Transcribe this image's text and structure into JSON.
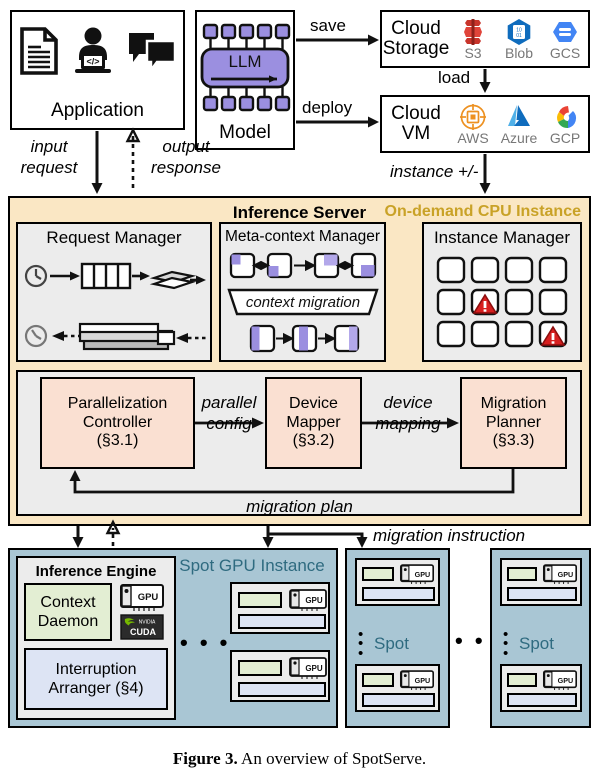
{
  "figure": {
    "caption_bold": "Figure 3.",
    "caption_rest": " An overview of SpotServe."
  },
  "colors": {
    "server_bg": "#fae7c4",
    "ondemand_text": "#c9a227",
    "spot_bg": "#a9c6d4",
    "spot_text": "#2f6b80",
    "panel_bg": "#ececec",
    "pink_box": "#fae0d2",
    "green_box": "#e3eed3",
    "blue_box": "#dde4f4",
    "llm_purple": "#9b8fe0",
    "warning_red": "#d81f1f"
  },
  "application": {
    "label": "Application",
    "icons": [
      "document-icon",
      "developer-icon",
      "chat-icon"
    ]
  },
  "model": {
    "label": "Model",
    "core_label": "LLM"
  },
  "cloud_storage": {
    "name_line1": "Cloud",
    "name_line2": "Storage",
    "providers": [
      {
        "caption": "S3",
        "icon": "aws-s3-icon"
      },
      {
        "caption": "Blob",
        "icon": "azure-blob-icon"
      },
      {
        "caption": "GCS",
        "icon": "google-cloud-storage-icon"
      }
    ]
  },
  "cloud_vm": {
    "name_line1": "Cloud",
    "name_line2": "VM",
    "providers": [
      {
        "caption": "AWS",
        "icon": "aws-ec2-icon"
      },
      {
        "caption": "Azure",
        "icon": "azure-icon"
      },
      {
        "caption": "GCP",
        "icon": "google-cloud-icon"
      }
    ]
  },
  "edges": {
    "save": "save",
    "deploy": "deploy",
    "load": "load",
    "input_request": "input\nrequest",
    "input_request_l1": "input",
    "input_request_l2": "request",
    "output_response_l1": "output",
    "output_response_l2": "response",
    "instance_pm": "instance +/-",
    "parallel_config_l1": "parallel",
    "parallel_config_l2": "config",
    "device_mapping_l1": "device",
    "device_mapping_l2": "mapping",
    "migration_plan": "migration plan",
    "migration_instruction": "migration instruction",
    "context_migration": "context migration"
  },
  "inference_server": {
    "title": "Inference Server",
    "badge": "On-demand CPU Instance",
    "request_manager": {
      "title": "Request Manager"
    },
    "meta_context_manager": {
      "title": "Meta-context Manager"
    },
    "instance_manager": {
      "title": "Instance Manager",
      "grid_rows": 3,
      "grid_cols": 4,
      "warning_cells": [
        [
          1,
          1
        ],
        [
          2,
          3
        ]
      ]
    },
    "pipeline": [
      {
        "line1": "Parallelization",
        "line2": "Controller",
        "line3": "(§3.1)"
      },
      {
        "line1": "Device",
        "line2": "Mapper",
        "line3": "(§3.2)"
      },
      {
        "line1": "Migration",
        "line2": "Planner",
        "line3": "(§3.3)"
      }
    ]
  },
  "spot_instances": {
    "primary_label": "Spot GPU Instance",
    "engine": {
      "title": "Inference Engine",
      "context_daemon_l1": "Context",
      "context_daemon_l2": "Daemon",
      "interruption_l1": "Interruption",
      "interruption_l2": "Arranger (§4)",
      "gpu_badge": "GPU",
      "cuda_badge_top": "NVIDIA",
      "cuda_badge_bottom": "CUDA"
    },
    "spot_word": "Spot",
    "ellipsis": "• • •",
    "vertical_ellipsis": "⋮",
    "gpu_label": "GPU"
  }
}
